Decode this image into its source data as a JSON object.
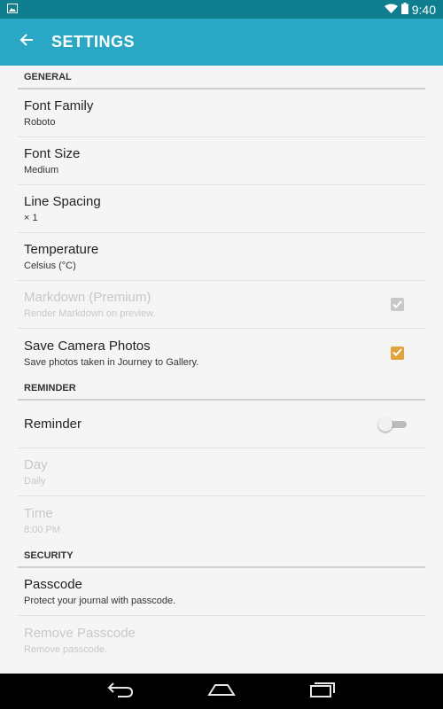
{
  "status_bar": {
    "time": "9:40"
  },
  "app_bar": {
    "title": "SETTINGS"
  },
  "sections": {
    "general": {
      "header": "GENERAL",
      "font_family": {
        "title": "Font Family",
        "value": "Roboto"
      },
      "font_size": {
        "title": "Font Size",
        "value": "Medium"
      },
      "line_spacing": {
        "title": "Line Spacing",
        "value": "× 1"
      },
      "temperature": {
        "title": "Temperature",
        "value": "Celsius (°C)"
      },
      "markdown": {
        "title": "Markdown (Premium)",
        "subtitle": "Render Markdown on preview.",
        "checked": true,
        "enabled": false
      },
      "save_camera": {
        "title": "Save Camera Photos",
        "subtitle": "Save photos taken in Journey to Gallery.",
        "checked": true,
        "enabled": true
      }
    },
    "reminder": {
      "header": "REMINDER",
      "reminder": {
        "title": "Reminder",
        "on": false
      },
      "day": {
        "title": "Day",
        "value": "Daily",
        "enabled": false
      },
      "time": {
        "title": "Time",
        "value": "8:00 PM",
        "enabled": false
      }
    },
    "security": {
      "header": "SECURITY",
      "passcode": {
        "title": "Passcode",
        "subtitle": "Protect your journal with passcode."
      },
      "remove_passcode": {
        "title": "Remove Passcode",
        "subtitle": "Remove passcode.",
        "enabled": false
      }
    }
  },
  "colors": {
    "status_bar": "#0f7f8f",
    "app_bar": "#2aa7c4",
    "checkbox_on": "#e3a33c",
    "disabled_text": "#c8c8c8"
  },
  "icons": {
    "back": "arrow-back-icon",
    "wifi": "wifi-icon",
    "battery": "battery-icon",
    "notification": "image-notification-icon",
    "nav_back": "nav-back-icon",
    "nav_home": "nav-home-icon",
    "nav_recents": "nav-recents-icon"
  }
}
